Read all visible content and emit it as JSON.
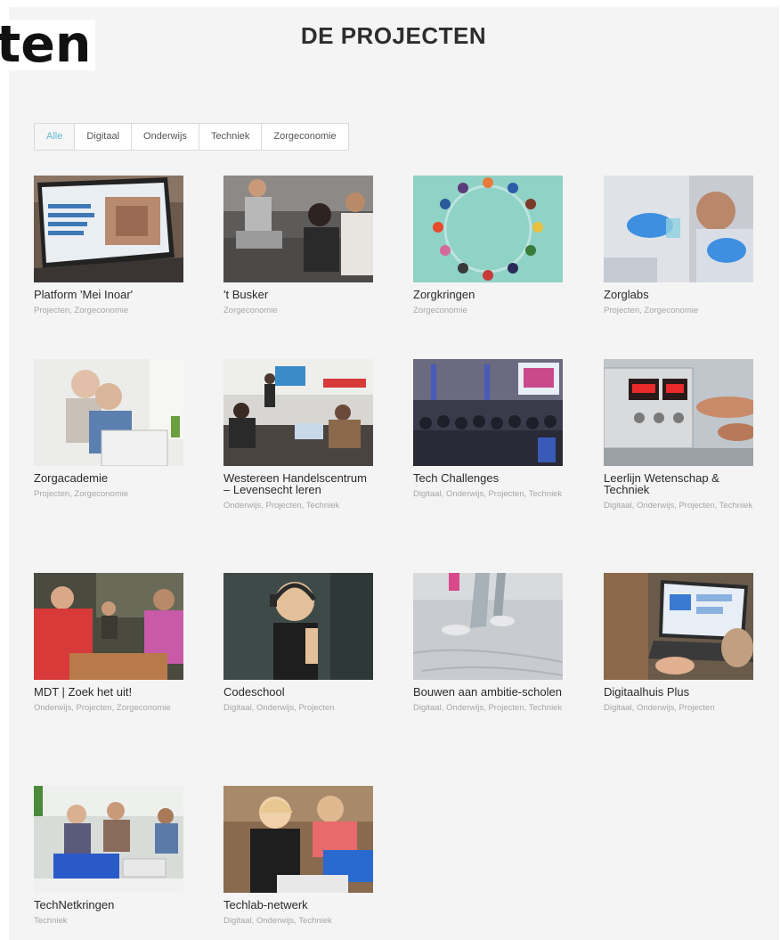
{
  "overlay_word": "ten",
  "heading": "DE PROJECTEN",
  "filters": [
    {
      "label": "Alle",
      "active": true
    },
    {
      "label": "Digitaal",
      "active": false
    },
    {
      "label": "Onderwijs",
      "active": false
    },
    {
      "label": "Techniek",
      "active": false
    },
    {
      "label": "Zorgeconomie",
      "active": false
    }
  ],
  "projects": [
    {
      "title": "Platform 'Mei Inoar'",
      "categories": "Projecten, Zorgeconomie",
      "image": "laptop-screen-photo"
    },
    {
      "title": "'t Busker",
      "categories": "Zorgeconomie",
      "image": "group-on-floor-photo"
    },
    {
      "title": "Zorgkringen",
      "categories": "Zorgeconomie",
      "image": "people-circle-illustration"
    },
    {
      "title": "Zorglabs",
      "categories": "Projecten, Zorgeconomie",
      "image": "lab-researcher-photo"
    },
    {
      "title": "Zorgacademie",
      "categories": "Projecten, Zorgeconomie",
      "image": "elderly-couple-laptop-photo"
    },
    {
      "title": "Westereen Handelscentrum – Levensecht leren",
      "categories": "Onderwijs, Projecten, Techniek",
      "image": "classroom-presentation-photo"
    },
    {
      "title": "Tech Challenges",
      "categories": "Digitaal, Onderwijs, Projecten, Techniek",
      "image": "auditorium-photo"
    },
    {
      "title": "Leerlijn Wetenschap & Techniek",
      "categories": "Digitaal, Onderwijs, Projecten, Techniek",
      "image": "lab-equipment-photo"
    },
    {
      "title": "MDT | Zoek het uit!",
      "categories": "Onderwijs, Projecten, Zorgeconomie",
      "image": "youth-meeting-photo"
    },
    {
      "title": "Codeschool",
      "categories": "Digitaal, Onderwijs, Projecten",
      "image": "boy-headphones-photo"
    },
    {
      "title": "Bouwen aan ambitie-scholen",
      "categories": "Digitaal, Onderwijs, Projecten, Techniek",
      "image": "walking-feet-photo"
    },
    {
      "title": "Digitaalhuis Plus",
      "categories": "Digitaal, Onderwijs, Projecten",
      "image": "laptop-desk-photo"
    },
    {
      "title": "TechNetkringen",
      "categories": "Techniek",
      "image": "kids-lego-photo"
    },
    {
      "title": "Techlab-netwerk",
      "categories": "Digitaal, Onderwijs, Techniek",
      "image": "girls-building-photo"
    }
  ]
}
